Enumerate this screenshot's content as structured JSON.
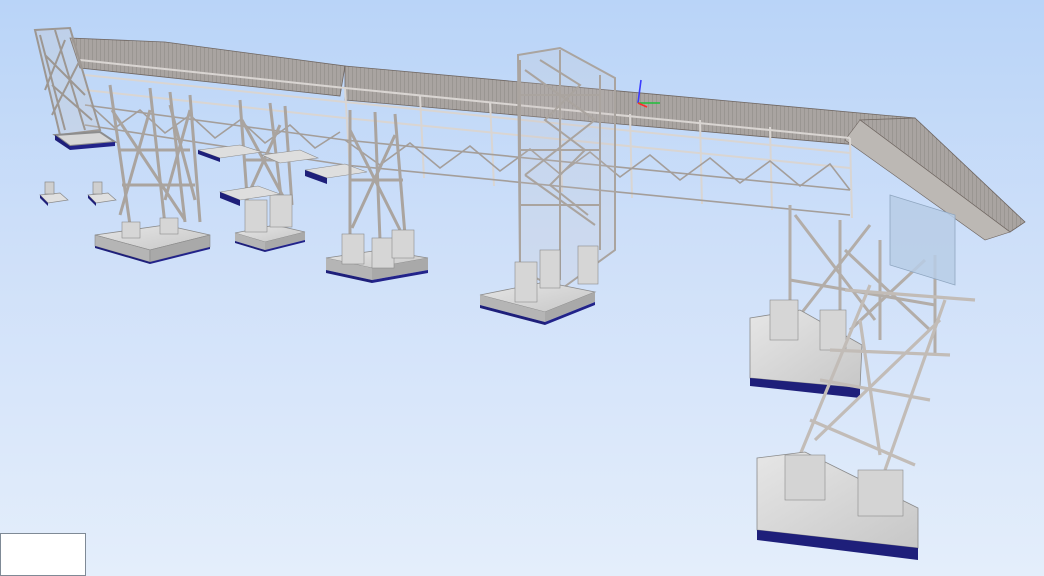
{
  "viewport": {
    "background_top": "#b9d4f8",
    "background_bottom": "#e4eefb",
    "structure_color": "#b9b2ad",
    "structure_highlight": "#eceae8",
    "structure_shadow": "#6f6661",
    "deck_color": "#a9a4a1",
    "concrete_color": "#c9c9c9",
    "concrete_side": "#9e9e9e",
    "foundation_base": "#1e1f7a",
    "axis_x_color": "#ff2a2a",
    "axis_y_color": "#1fbf3a",
    "axis_z_color": "#3b3bff"
  },
  "axis_gizmo": {
    "icon": "xyz-axis-icon"
  },
  "overlay_box": {
    "icon": "blank-panel"
  }
}
